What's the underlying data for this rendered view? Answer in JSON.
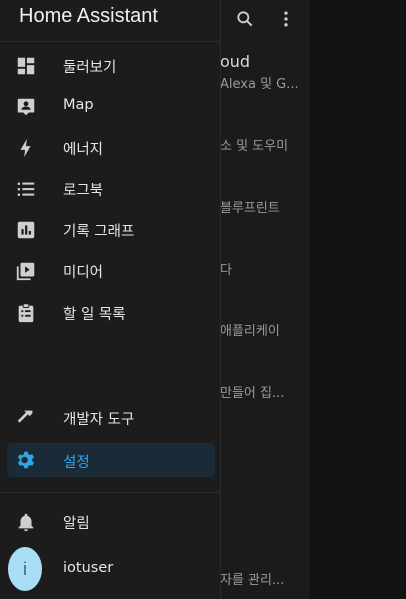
{
  "app": {
    "title": "Home Assistant"
  },
  "background_page": {
    "title_fragment": "oud",
    "lines": [
      "Alexa 및 G...",
      "소 및 도우미",
      "블루프린트",
      "다",
      "애플리케이",
      "만들어 집...",
      "자를 관리..."
    ]
  },
  "drawer": {
    "items": [
      {
        "label": "둘러보기",
        "icon": "dashboard-icon"
      },
      {
        "label": "Map",
        "icon": "map-account-icon"
      },
      {
        "label": "에너지",
        "icon": "lightning-bolt-icon"
      },
      {
        "label": "로그북",
        "icon": "list-icon"
      },
      {
        "label": "기록 그래프",
        "icon": "chart-box-icon"
      },
      {
        "label": "미디어",
        "icon": "media-play-icon"
      },
      {
        "label": "할 일 목록",
        "icon": "clipboard-list-icon"
      },
      {
        "label": "개발자 도구",
        "icon": "hammer-icon"
      },
      {
        "label": "설정",
        "icon": "gear-icon",
        "selected": true
      }
    ],
    "notifications": {
      "label": "알림",
      "icon": "bell-icon"
    },
    "user": {
      "name": "iotuser",
      "initial": "i"
    }
  },
  "colors": {
    "accent": "#2ea7e8",
    "drawer_bg": "#1c1c1c",
    "selected_bg": "#1a2a36",
    "avatar_bg": "#a9ddf6"
  }
}
